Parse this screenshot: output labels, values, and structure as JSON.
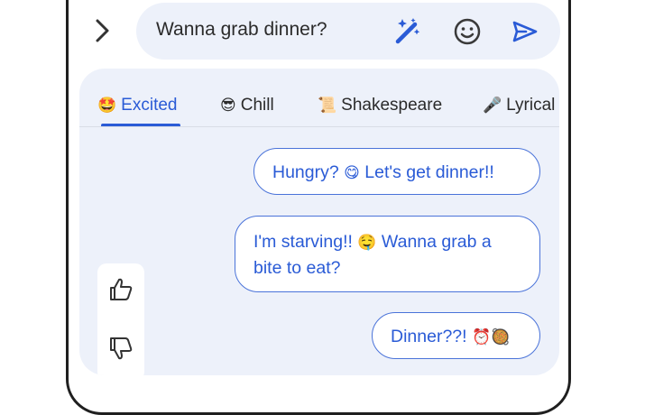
{
  "compose": {
    "text": "Wanna grab dinner?"
  },
  "icons": {
    "back": "chevron-right-icon",
    "magic": "magic-wand-icon",
    "emoji": "smiley-icon",
    "send": "send-icon",
    "like": "thumbs-up-icon",
    "dislike": "thumbs-down-icon"
  },
  "tabs": [
    {
      "emoji": "🤩",
      "label": "Excited",
      "active": true
    },
    {
      "emoji": "😎",
      "label": "Chill",
      "active": false
    },
    {
      "emoji": "📜",
      "label": "Shakespeare",
      "active": false
    },
    {
      "emoji": "🎤",
      "label": "Lyrical",
      "active": false
    }
  ],
  "suggestions": [
    {
      "before": "Hungry? ",
      "emoji": "😋",
      "after": " Let's get dinner!!"
    },
    {
      "line1_before": "I'm starving!! ",
      "line1_emoji": "🤤",
      "line1_after": " Wanna grab a",
      "line2": "bite to eat?"
    },
    {
      "before": "Dinner??! ",
      "emoji": "⏰🥘",
      "after": ""
    }
  ],
  "colors": {
    "accent": "#2a5bd6",
    "panel_bg": "#edf1fa",
    "bubble_border": "#4a73d9"
  }
}
